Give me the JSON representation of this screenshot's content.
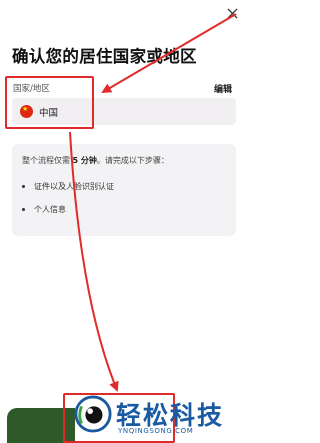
{
  "header": {
    "title": "确认您的居住国家或地区",
    "close_icon": "close-icon"
  },
  "country_field": {
    "label": "国家/地区",
    "edit_label": "编辑",
    "selected_country": "中国",
    "flag_icon": "china-flag-icon"
  },
  "info_card": {
    "intro_before": "整个流程仅需 ",
    "intro_bold": "5 分钟",
    "intro_after": "。请完成以下步骤：",
    "steps": [
      "证件以及人脸识别认证",
      "个人信息"
    ]
  },
  "watermark": {
    "brand": "轻松科技",
    "url": "YNQINGSONG.COM"
  },
  "colors": {
    "annotation_red": "#e02b2b",
    "button_green": "#2e5a2a",
    "watermark_blue": "#1a5aa0",
    "flag_red": "#de2910"
  }
}
